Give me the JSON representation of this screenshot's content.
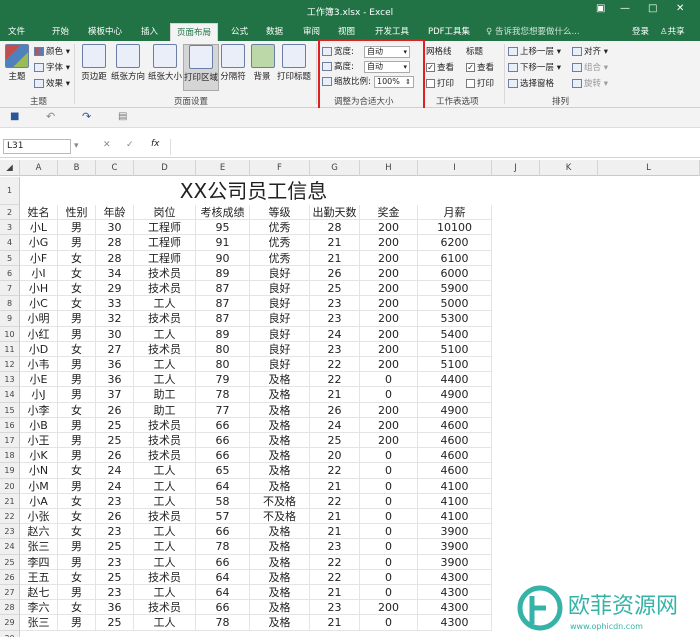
{
  "window": {
    "title": "工作簿3.xlsx - Excel",
    "min": "—",
    "restore": "□",
    "close": "✕",
    "opt": "▣"
  },
  "tabs": [
    "文件",
    "开始",
    "模板中心",
    "插入",
    "页面布局",
    "公式",
    "数据",
    "审阅",
    "视图",
    "开发工具",
    "PDF工具集"
  ],
  "tell_me": "告诉我您想要做什么...",
  "login": "登录",
  "share": "共享",
  "ribbon": {
    "theme": {
      "label": "主题",
      "colors": "颜色",
      "fonts": "字体",
      "effects": "效果",
      "group": "主题"
    },
    "page_setup": {
      "margins": "页边距",
      "orientation": "纸张方向",
      "size": "纸张大小",
      "print_area": "打印区域",
      "breaks": "分隔符",
      "background": "背景",
      "print_titles": "打印标题",
      "group": "页面设置"
    },
    "scale": {
      "width_label": "宽度:",
      "width_value": "自动",
      "height_label": "高度:",
      "height_value": "自动",
      "scale_label": "缩放比例:",
      "scale_value": "100%",
      "group": "调整为合适大小"
    },
    "sheet_options": {
      "gridlines": "网格线",
      "headings": "标题",
      "view1": "查看",
      "view2": "查看",
      "print1": "打印",
      "print2": "打印",
      "group": "工作表选项"
    },
    "arrange": {
      "forward": "上移一层",
      "backward": "下移一层",
      "selection": "选择窗格",
      "align": "对齐",
      "group_btn": "组合",
      "rotate": "旋转",
      "group": "排列"
    }
  },
  "formula_bar": {
    "name_box": "L31",
    "cancel": "✕",
    "enter": "✓",
    "fx": "fx",
    "value": ""
  },
  "columns": [
    "A",
    "B",
    "C",
    "D",
    "E",
    "F",
    "G",
    "H",
    "I",
    "J",
    "K",
    "L"
  ],
  "sheet_title": "XX公司员工信息",
  "headers": [
    "姓名",
    "性别",
    "年龄",
    "岗位",
    "考核成绩",
    "等级",
    "出勤天数",
    "奖金",
    "月薪"
  ],
  "rows": [
    [
      "小L",
      "男",
      "30",
      "工程师",
      "95",
      "优秀",
      "28",
      "200",
      "10100"
    ],
    [
      "小G",
      "男",
      "28",
      "工程师",
      "91",
      "优秀",
      "21",
      "200",
      "6200"
    ],
    [
      "小F",
      "女",
      "28",
      "工程师",
      "90",
      "优秀",
      "21",
      "200",
      "6100"
    ],
    [
      "小I",
      "女",
      "34",
      "技术员",
      "89",
      "良好",
      "26",
      "200",
      "6000"
    ],
    [
      "小H",
      "女",
      "29",
      "技术员",
      "87",
      "良好",
      "25",
      "200",
      "5900"
    ],
    [
      "小C",
      "女",
      "33",
      "工人",
      "87",
      "良好",
      "23",
      "200",
      "5000"
    ],
    [
      "小明",
      "男",
      "32",
      "技术员",
      "87",
      "良好",
      "23",
      "200",
      "5300"
    ],
    [
      "小红",
      "男",
      "30",
      "工人",
      "89",
      "良好",
      "24",
      "200",
      "5400"
    ],
    [
      "小D",
      "女",
      "27",
      "技术员",
      "80",
      "良好",
      "23",
      "200",
      "5100"
    ],
    [
      "小韦",
      "男",
      "36",
      "工人",
      "80",
      "良好",
      "22",
      "200",
      "5100"
    ],
    [
      "小E",
      "男",
      "36",
      "工人",
      "79",
      "及格",
      "22",
      "0",
      "4400"
    ],
    [
      "小J",
      "男",
      "37",
      "助工",
      "78",
      "及格",
      "21",
      "0",
      "4900"
    ],
    [
      "小李",
      "女",
      "26",
      "助工",
      "77",
      "及格",
      "26",
      "200",
      "4900"
    ],
    [
      "小B",
      "男",
      "25",
      "技术员",
      "66",
      "及格",
      "24",
      "200",
      "4600"
    ],
    [
      "小王",
      "男",
      "25",
      "技术员",
      "66",
      "及格",
      "25",
      "200",
      "4600"
    ],
    [
      "小K",
      "男",
      "26",
      "技术员",
      "66",
      "及格",
      "20",
      "0",
      "4600"
    ],
    [
      "小N",
      "女",
      "24",
      "工人",
      "65",
      "及格",
      "22",
      "0",
      "4600"
    ],
    [
      "小M",
      "男",
      "24",
      "工人",
      "64",
      "及格",
      "21",
      "0",
      "4100"
    ],
    [
      "小A",
      "女",
      "23",
      "工人",
      "58",
      "不及格",
      "22",
      "0",
      "4100"
    ],
    [
      "小张",
      "女",
      "26",
      "技术员",
      "57",
      "不及格",
      "21",
      "0",
      "4100"
    ],
    [
      "赵六",
      "女",
      "23",
      "工人",
      "66",
      "及格",
      "21",
      "0",
      "3900"
    ],
    [
      "张三",
      "男",
      "25",
      "工人",
      "78",
      "及格",
      "23",
      "0",
      "3900"
    ],
    [
      "李四",
      "男",
      "23",
      "工人",
      "66",
      "及格",
      "22",
      "0",
      "3900"
    ],
    [
      "王五",
      "女",
      "25",
      "技术员",
      "64",
      "及格",
      "22",
      "0",
      "4300"
    ],
    [
      "赵七",
      "男",
      "23",
      "工人",
      "64",
      "及格",
      "21",
      "0",
      "4300"
    ],
    [
      "李六",
      "女",
      "36",
      "技术员",
      "66",
      "及格",
      "23",
      "200",
      "4300"
    ],
    [
      "张三",
      "男",
      "25",
      "工人",
      "78",
      "及格",
      "21",
      "0",
      "4300"
    ]
  ],
  "watermark": {
    "text": "欧菲资源网",
    "sub": "www.ophicdn.com"
  }
}
